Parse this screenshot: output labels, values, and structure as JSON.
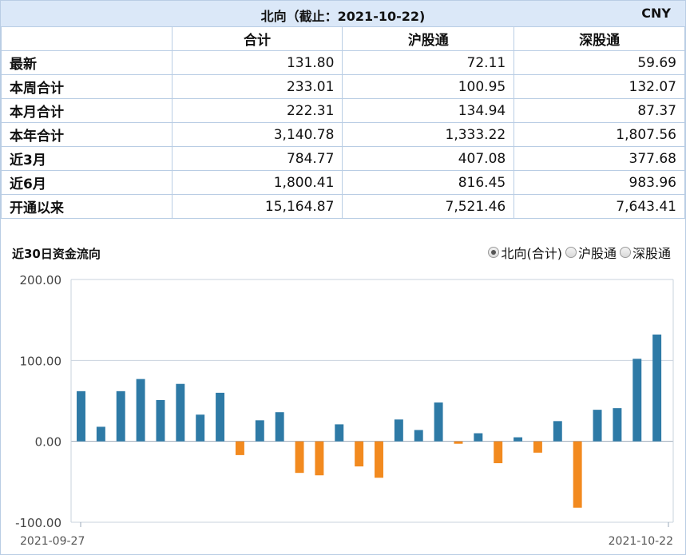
{
  "header": {
    "title": "北向（截止：2021-10-22)",
    "currency": "CNY"
  },
  "table": {
    "columns": [
      "合计",
      "沪股通",
      "深股通"
    ],
    "rows": [
      {
        "label": "最新",
        "values": [
          "131.80",
          "72.11",
          "59.69"
        ]
      },
      {
        "label": "本周合计",
        "values": [
          "233.01",
          "100.95",
          "132.07"
        ]
      },
      {
        "label": "本月合计",
        "values": [
          "222.31",
          "134.94",
          "87.37"
        ]
      },
      {
        "label": "本年合计",
        "values": [
          "3,140.78",
          "1,333.22",
          "1,807.56"
        ]
      },
      {
        "label": "近3月",
        "values": [
          "784.77",
          "407.08",
          "377.68"
        ]
      },
      {
        "label": "近6月",
        "values": [
          "1,800.41",
          "816.45",
          "983.96"
        ]
      },
      {
        "label": "开通以来",
        "values": [
          "15,164.87",
          "7,521.46",
          "7,643.41"
        ]
      }
    ]
  },
  "chart_section": {
    "title": "近30日资金流向",
    "options": [
      {
        "label": "北向(合计)",
        "selected": true
      },
      {
        "label": "沪股通",
        "selected": false
      },
      {
        "label": "深股通",
        "selected": false
      }
    ]
  },
  "chart_data": {
    "type": "bar",
    "title": "近30日资金流向",
    "ylim": [
      -100,
      200
    ],
    "yticks": [
      "200.00",
      "100.00",
      "0.00",
      "-100.00"
    ],
    "x_start_label": "2021-09-27",
    "x_end_label": "2021-10-22",
    "values": [
      62,
      18,
      62,
      77,
      51,
      71,
      33,
      60,
      -17,
      26,
      36,
      -39,
      -42,
      21,
      -31,
      -45,
      27,
      14,
      48,
      -3,
      10,
      -27,
      5,
      -14,
      25,
      -82,
      39,
      41,
      102,
      132
    ],
    "colors": {
      "positive": "#2e7aa6",
      "negative": "#f28a1f"
    },
    "grid": true
  }
}
